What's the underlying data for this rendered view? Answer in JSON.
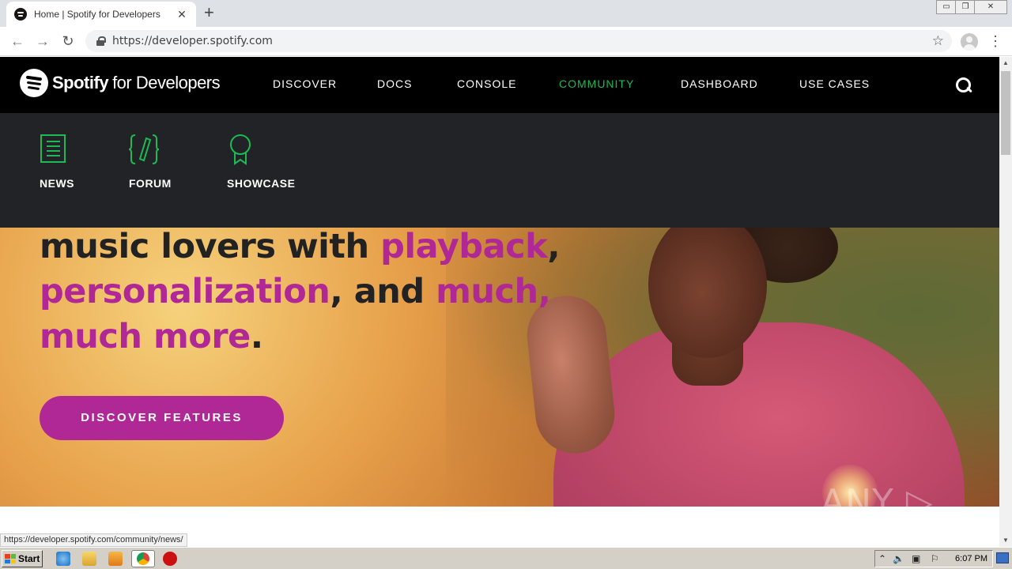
{
  "browser": {
    "tab_title": "Home | Spotify for Developers",
    "tab_close": "✕",
    "new_tab": "+",
    "url": "https://developer.spotify.com",
    "back": "←",
    "forward": "→",
    "reload": "↻",
    "bookmark_star": "☆",
    "menu": "⋮",
    "window_controls": [
      "▭",
      "❐",
      "✕"
    ]
  },
  "site": {
    "brand": "Spotify",
    "brand_suffix": "for Developers",
    "nav": [
      {
        "label": "DISCOVER"
      },
      {
        "label": "DOCS"
      },
      {
        "label": "CONSOLE"
      },
      {
        "label": "COMMUNITY"
      },
      {
        "label": "DASHBOARD"
      },
      {
        "label": "USE CASES"
      }
    ],
    "active_nav": "COMMUNITY",
    "accent_color": "#1db954",
    "cta_color": "#af2896"
  },
  "community_menu": {
    "items": [
      {
        "label": "NEWS",
        "icon": "newspaper-icon"
      },
      {
        "label": "FORUM",
        "icon": "forum-icon"
      },
      {
        "label": "SHOWCASE",
        "icon": "award-icon"
      }
    ]
  },
  "hero": {
    "line1_a": "music lovers with ",
    "line1_b": "playback",
    "line1_c": ",",
    "line2_a": "personalization",
    "line2_b": ", and ",
    "line2_c": "much,",
    "line3_a": "much more",
    "line3_b": ".",
    "cta": "DISCOVER FEATURES"
  },
  "watermark": "ANY ▷ RUN",
  "status_url": "https://developer.spotify.com/community/news/",
  "taskbar": {
    "start": "Start",
    "clock": "6:07 PM"
  }
}
